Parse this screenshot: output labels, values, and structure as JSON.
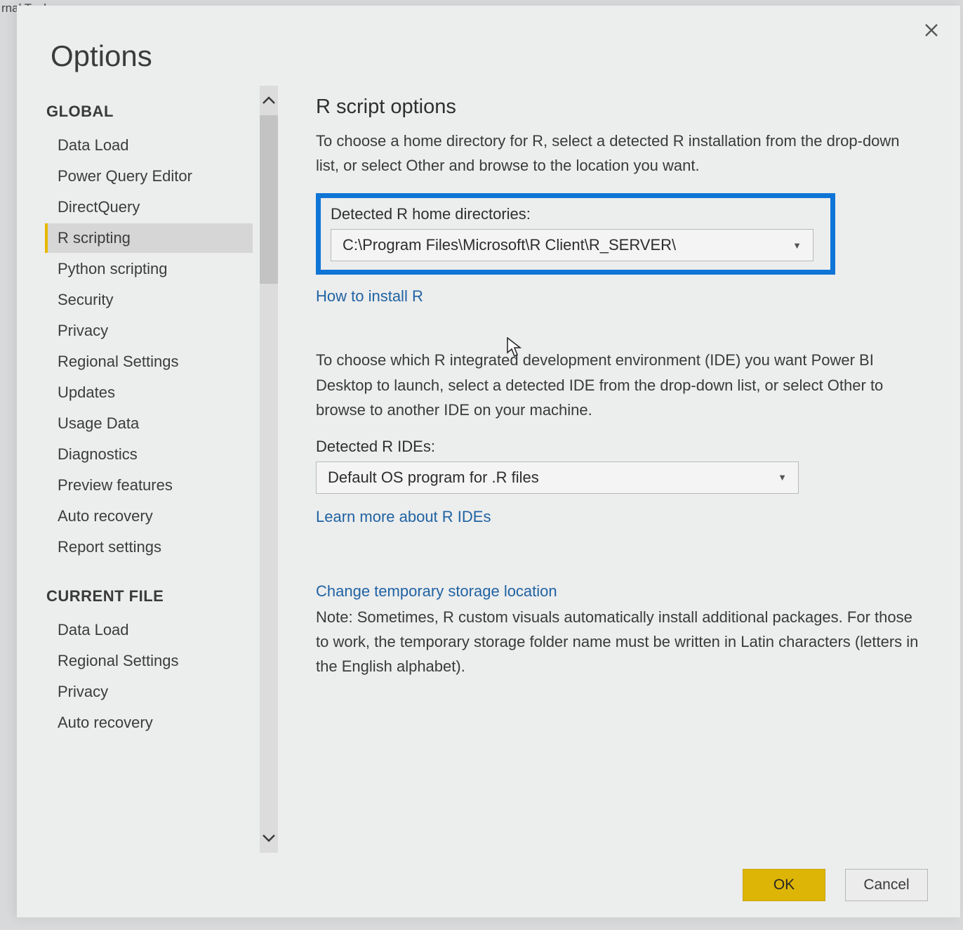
{
  "bg_tab": "rnal Tools",
  "dialog": {
    "title": "Options"
  },
  "sidebar": {
    "global_heading": "GLOBAL",
    "current_heading": "CURRENT FILE",
    "global_items": [
      "Data Load",
      "Power Query Editor",
      "DirectQuery",
      "R scripting",
      "Python scripting",
      "Security",
      "Privacy",
      "Regional Settings",
      "Updates",
      "Usage Data",
      "Diagnostics",
      "Preview features",
      "Auto recovery",
      "Report settings"
    ],
    "selected_index": 3,
    "current_items": [
      "Data Load",
      "Regional Settings",
      "Privacy",
      "Auto recovery"
    ]
  },
  "content": {
    "title": "R script options",
    "intro": "To choose a home directory for R, select a detected R installation from the drop-down list, or select Other and browse to the location you want.",
    "home_label": "Detected R home directories:",
    "home_value": "C:\\Program Files\\Microsoft\\R Client\\R_SERVER\\",
    "install_link": "How to install R",
    "ide_intro": "To choose which R integrated development environment (IDE) you want Power BI Desktop to launch, select a detected IDE from the drop-down list, or select Other to browse to another IDE on your machine.",
    "ide_label": "Detected R IDEs:",
    "ide_value": "Default OS program for .R files",
    "ide_link": "Learn more about R IDEs",
    "storage_link": "Change temporary storage location",
    "storage_note": "Note: Sometimes, R custom visuals automatically install additional packages. For those to work, the temporary storage folder name must be written in Latin characters (letters in the English alphabet)."
  },
  "footer": {
    "ok": "OK",
    "cancel": "Cancel"
  }
}
